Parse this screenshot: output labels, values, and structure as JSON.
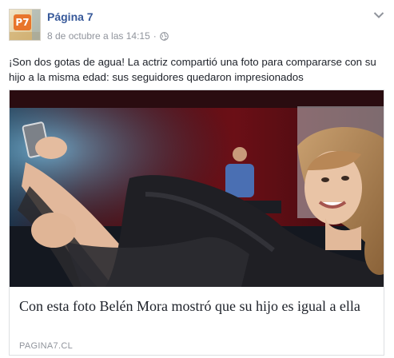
{
  "header": {
    "page_name": "Página 7",
    "timestamp": "8 de octubre a las 14:15",
    "separator": "·",
    "avatar_text": "P7",
    "privacy_icon": "globe-icon",
    "options_icon": "chevron-down-icon"
  },
  "post": {
    "text": "¡Son dos gotas de agua! La actriz compartió una foto para compararse con su hijo a la misma edad: sus seguidores quedaron impresionados"
  },
  "link_card": {
    "title": "Con esta foto Belén Mora mostró que su hijo es igual a ella",
    "domain": "PAGINA7.CL"
  },
  "colors": {
    "link_blue": "#365899",
    "meta_gray": "#90949c",
    "text": "#1d2129",
    "card_border": "#dddfe2"
  }
}
